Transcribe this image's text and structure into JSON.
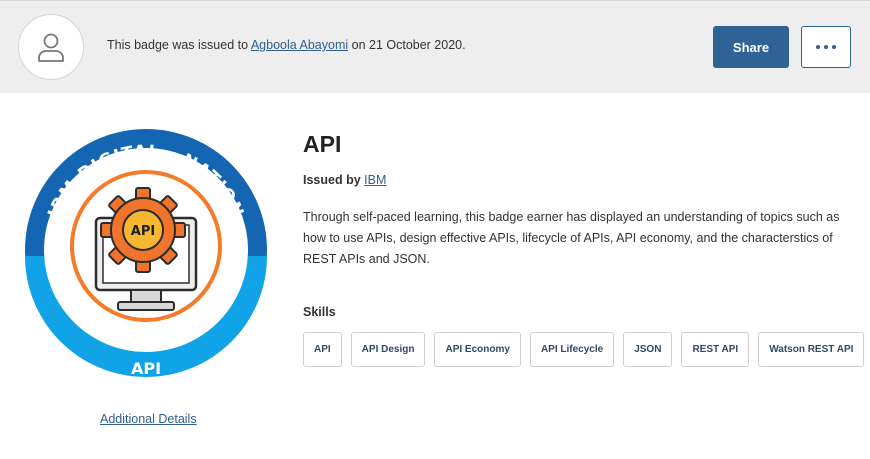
{
  "header": {
    "issued_prefix": "This badge was issued to ",
    "recipient": "Agboola Abayomi",
    "issued_date_text": " on 21 October 2020.",
    "share_label": "Share",
    "more_icon": "ellipsis-icon",
    "avatar_icon": "user-icon"
  },
  "badge": {
    "ring_top_text": "IBM DIGITAL - NATION",
    "center_text": "API",
    "bottom_text": "API",
    "colors": {
      "dark_blue": "#1466b3",
      "light_blue": "#10a3e8",
      "orange": "#f47b2a",
      "gear": "#f0742c"
    }
  },
  "additional_details_label": "Additional Details",
  "main": {
    "title": "API",
    "issued_by_label": "Issued by",
    "issuer": "IBM",
    "description": "Through self-paced learning, this badge earner has displayed an understanding of topics such as how to use APIs, design effective APIs, lifecycle of APIs, API economy, and the characterstics of REST APIs and JSON.",
    "skills_heading": "Skills",
    "skills": [
      "API",
      "API Design",
      "API Economy",
      "API Lifecycle",
      "JSON",
      "REST API",
      "Watson REST API"
    ]
  },
  "colors": {
    "accent": "#2f6396",
    "link": "#2e5f8f",
    "header_bg": "#eeeeee"
  }
}
